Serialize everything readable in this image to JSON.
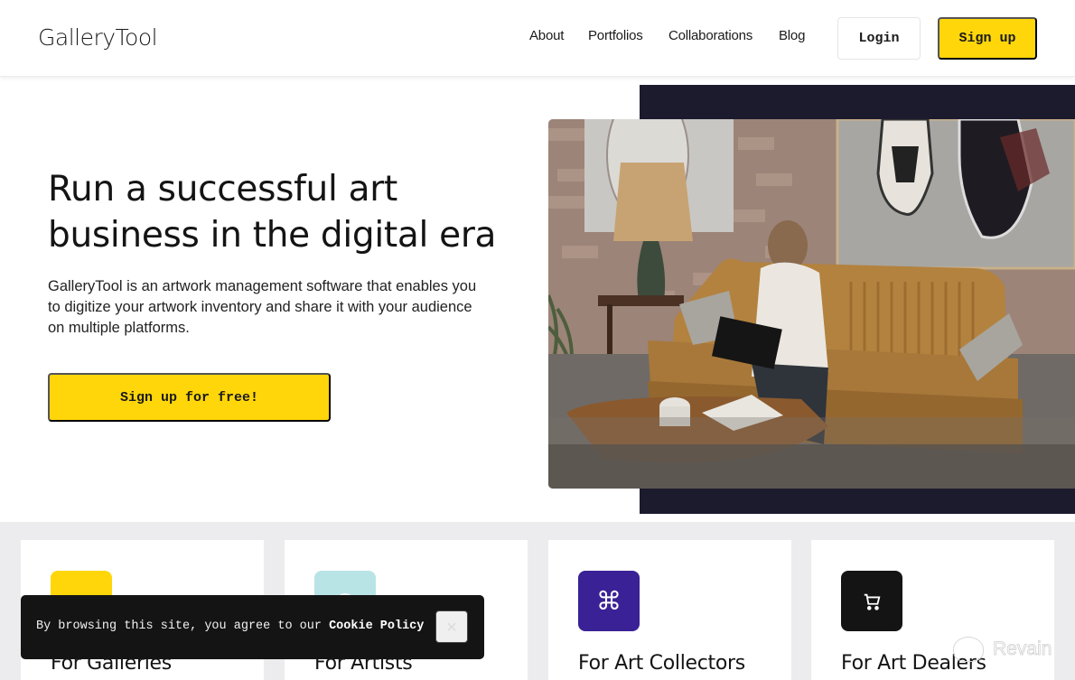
{
  "header": {
    "logo": "GalleryTool",
    "nav": [
      {
        "label": "About"
      },
      {
        "label": "Portfolios"
      },
      {
        "label": "Collaborations"
      },
      {
        "label": "Blog"
      }
    ],
    "login_label": "Login",
    "signup_label": "Sign up"
  },
  "hero": {
    "title_line1": "Run a successful art",
    "title_line2": "business in the digital era",
    "description": "GalleryTool is an artwork management software that enables you to digitize your artwork inventory and share it with your audience on multiple platforms.",
    "cta_label": "Sign up for free!",
    "image_alt": "Woman working on a laptop on a mustard sofa in a loft with sneaker paintings"
  },
  "features": [
    {
      "title": "For Galleries",
      "icon": "home-icon",
      "glyph": "⌂",
      "color": "#ffd60a"
    },
    {
      "title": "For Artists",
      "icon": "palette-icon",
      "glyph": "◎",
      "color": "#b8e4e6"
    },
    {
      "title": "For Art Collectors",
      "icon": "command-icon",
      "glyph": "⌘",
      "color": "#3a2196"
    },
    {
      "title": "For Art Dealers",
      "icon": "cart-icon",
      "glyph": "🛒",
      "color": "#141414"
    }
  ],
  "cookie": {
    "text": "By browsing this site, you agree to our ",
    "link": "Cookie Policy",
    "close_glyph": "✕"
  },
  "watermark": {
    "text": "Revain"
  },
  "colors": {
    "accent_yellow": "#ffd60a",
    "dark_navy": "#1c1b2e",
    "cookie_bg": "#141414",
    "section_bg": "#ececee"
  }
}
